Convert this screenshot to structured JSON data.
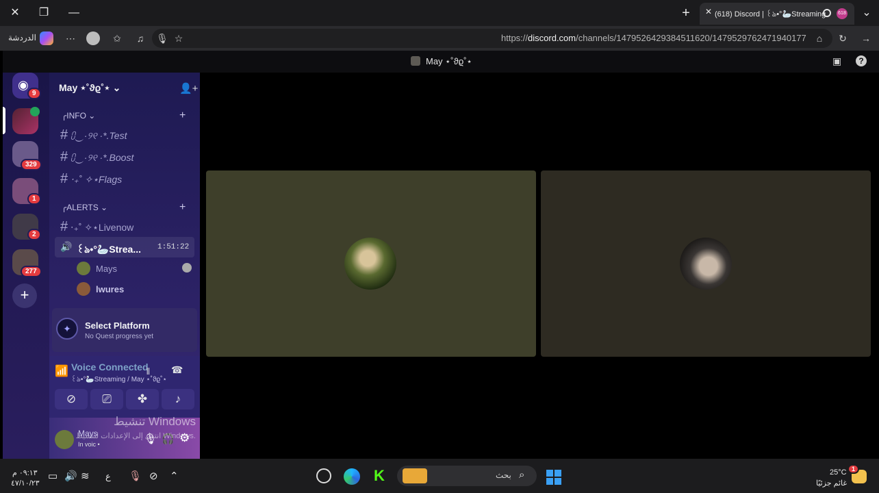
{
  "browser": {
    "tab_title": "(618) Discord | ꒰ঌ•°🦢Streaming",
    "url_prefix": "https://",
    "url_host": "discord.com",
    "url_path": "/channels/1479526429384511620/1479529762471940177",
    "profile_label": "الدردشة",
    "new_tab_icon": "plus-icon",
    "colors": {
      "bar": "#1b1b1d",
      "omnibox": "#1f1f21"
    }
  },
  "discord": {
    "window_title": "May ⋆˚ϑϱ˚⋆",
    "server_name": "May ⋆˚ϑϱ˚⋆",
    "guild_badges": [
      "9",
      "329",
      "1",
      "2",
      "277"
    ],
    "categories": [
      {
        "name": "INFO",
        "channels": [
          "⩇‿·୨୧ ·*.Test",
          "⩇‿·୨୧ ·*.Boost",
          "‧₊˚ ✧⋆Flags"
        ]
      },
      {
        "name": "ALERTS",
        "channels": [
          "‧₊˚ ✧⋆Livenow"
        ]
      }
    ],
    "voice_channel": {
      "name": "꒰ঌ•°🦢Strea...",
      "timer": "1:51:22"
    },
    "voice_users": [
      "Mays",
      "lwures"
    ],
    "quest": {
      "title": "Select Platform",
      "subtitle": "No Quest progress yet"
    },
    "voice_panel": {
      "status": "Voice Connected",
      "location": "꒰ঌ•°🦢Streaming / May ⋆˚ϑϱ˚⋆"
    },
    "user": {
      "name": "Mays",
      "status": "In voic •"
    },
    "watermark": {
      "line1": "تنشيط Windows",
      "line2": "انتقل إلى الإعدادات لتنشيط Windows."
    },
    "colors": {
      "tile1": "#3e3f2a",
      "tile2": "#2e2b22",
      "accent": "#5865f2"
    }
  },
  "taskbar": {
    "time": "٠٩:١٣ م",
    "date": "٤٧/١٠/٢٣",
    "lang": "ع",
    "search_placeholder": "بحث",
    "weather_temp": "25°C",
    "weather_desc": "غائم جزئيًا",
    "weather_badge": "1"
  }
}
